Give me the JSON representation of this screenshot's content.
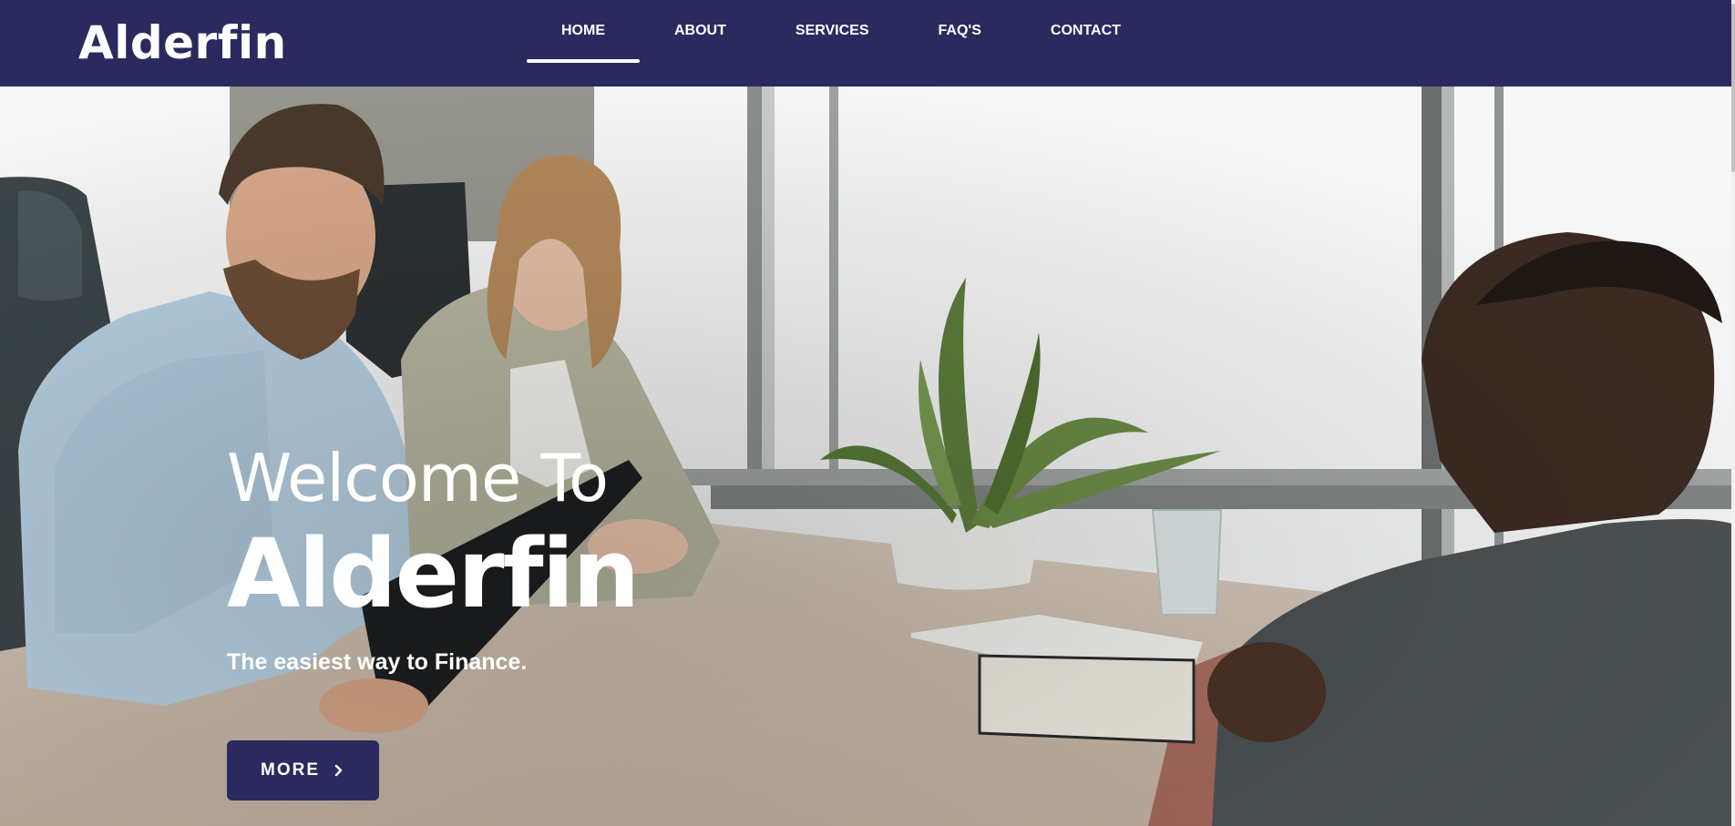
{
  "header": {
    "logo": "Alderfin",
    "nav": [
      {
        "label": "HOME",
        "active": true
      },
      {
        "label": "ABOUT",
        "active": false
      },
      {
        "label": "SERVICES",
        "active": false
      },
      {
        "label": "FAQ'S",
        "active": false
      },
      {
        "label": "CONTACT",
        "active": false
      }
    ]
  },
  "hero": {
    "welcome": "Welcome To",
    "brand": "Alderfin",
    "tagline": "The easiest way to Finance.",
    "button_label": "MORE",
    "button_icon": "chevron-right-icon"
  },
  "colors": {
    "primary": "#2b2a5e",
    "text_on_dark": "#ffffff"
  }
}
